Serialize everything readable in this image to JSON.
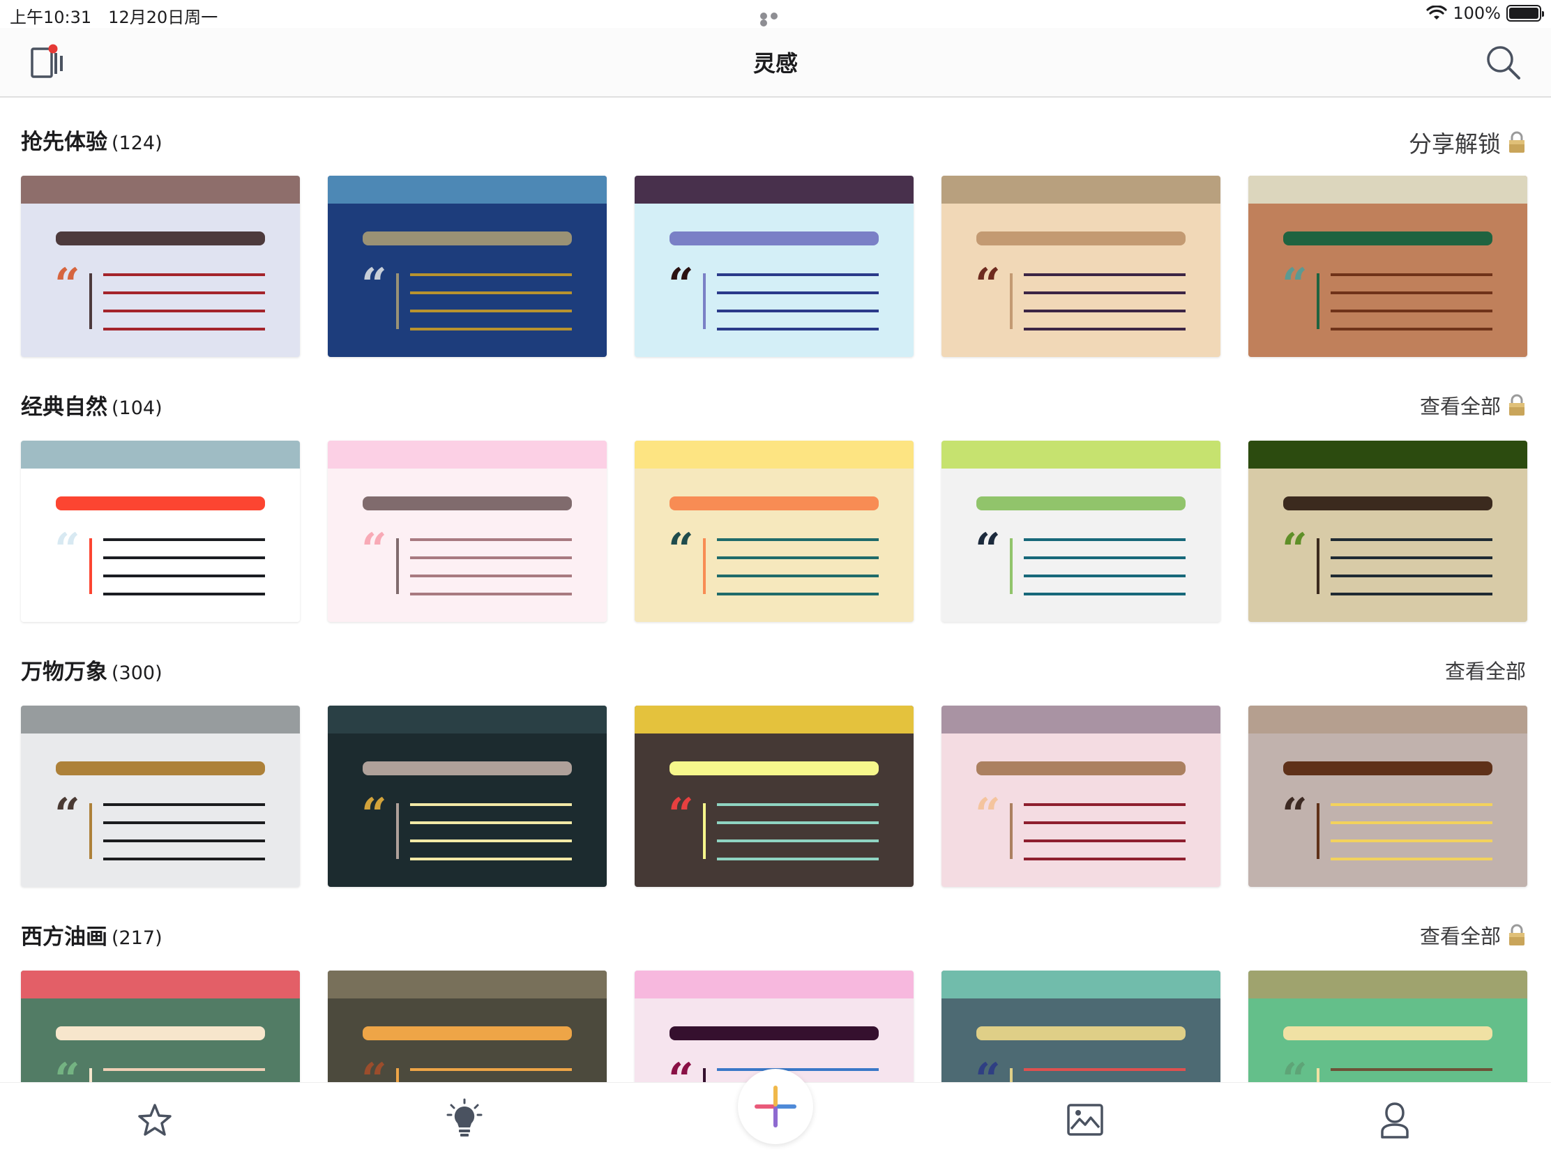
{
  "status_bar": {
    "time": "上午10:31",
    "date": "12月20日周一",
    "battery": "100%"
  },
  "nav": {
    "title": "灵感"
  },
  "sections": [
    {
      "title": "抢先体验",
      "count": "(124)",
      "action": "分享解锁",
      "locked": true,
      "cards": [
        {
          "bg": "#e0e3f1",
          "band": "#8e6e6b",
          "pill": "#4d3a3c",
          "quote": "#d6653f",
          "bar": "#4d3a3c",
          "lines": "#a4242b"
        },
        {
          "bg": "#1d3d7c",
          "band": "#4d88b5",
          "pill": "#9a9275",
          "quote": "#c8cfd8",
          "bar": "#9a9275",
          "lines": "#b8932f"
        },
        {
          "bg": "#d4eff7",
          "band": "#48304c",
          "pill": "#7a80c6",
          "quote": "#2b1111",
          "bar": "#7a80c6",
          "lines": "#2a3a8a"
        },
        {
          "bg": "#f1d8b7",
          "band": "#b8a07e",
          "pill": "#c39a72",
          "quote": "#6e2b1f",
          "bar": "#c39a72",
          "lines": "#3c2545"
        },
        {
          "bg": "#c0805b",
          "band": "#dcd6bd",
          "pill": "#1f6340",
          "quote": "#5c9a92",
          "bar": "#1f6340",
          "lines": "#6f3219"
        }
      ]
    },
    {
      "title": "经典自然",
      "count": "(104)",
      "action": "查看全部",
      "locked": true,
      "cards": [
        {
          "bg": "#ffffff",
          "band": "#9fbcc4",
          "pill": "#fc4531",
          "quote": "#d8e9f2",
          "bar": "#fc4531",
          "lines": "#1b1d22"
        },
        {
          "bg": "#fdf0f4",
          "band": "#fcd0e5",
          "pill": "#806b6d",
          "quote": "#f8aab6",
          "bar": "#806b6d",
          "lines": "#a87a80"
        },
        {
          "bg": "#f6e8bd",
          "band": "#fde482",
          "pill": "#f88c54",
          "quote": "#1f4c4d",
          "bar": "#f88c54",
          "lines": "#1f6b6a"
        },
        {
          "bg": "#f2f2f2",
          "band": "#c6e26f",
          "pill": "#91c46b",
          "quote": "#1c2a3c",
          "bar": "#91c46b",
          "lines": "#17687a"
        },
        {
          "bg": "#d8cba7",
          "band": "#2c4b0f",
          "pill": "#3b2a1e",
          "quote": "#5f8f28",
          "bar": "#3b2a1e",
          "lines": "#1f2a33"
        }
      ]
    },
    {
      "title": "万物万象",
      "count": "(300)",
      "action": "查看全部",
      "locked": false,
      "cards": [
        {
          "bg": "#e9eaec",
          "band": "#979c9e",
          "pill": "#ad8139",
          "quote": "#4a3a33",
          "bar": "#ad8139",
          "lines": "#1b1c1e"
        },
        {
          "bg": "#1c2b2f",
          "band": "#2a4045",
          "pill": "#afa19a",
          "quote": "#d2a33b",
          "bar": "#afa19a",
          "lines": "#f2e9a6"
        },
        {
          "bg": "#453935",
          "band": "#e4c23d",
          "pill": "#f6f78c",
          "quote": "#e84040",
          "bar": "#f6f78c",
          "lines": "#8fd4c2"
        },
        {
          "bg": "#f4dce2",
          "band": "#a993a3",
          "pill": "#ab8060",
          "quote": "#f4c49e",
          "bar": "#ab8060",
          "lines": "#8e1f2f"
        },
        {
          "bg": "#c1b2ad",
          "band": "#b59f8f",
          "pill": "#5f3119",
          "quote": "#3d2a23",
          "bar": "#5f3119",
          "lines": "#f3d25c"
        }
      ]
    },
    {
      "title": "西方油画",
      "count": "(217)",
      "action": "查看全部",
      "locked": true,
      "cards": [
        {
          "bg": "#527c65",
          "band": "#e35f67",
          "pill": "#f7e6cc",
          "quote": "#74b382",
          "bar": "#f7e6cc",
          "lines": "#f0cfb6"
        },
        {
          "bg": "#4c4a3d",
          "band": "#78705a",
          "pill": "#eea547",
          "quote": "#9b4d2c",
          "bar": "#eea547",
          "lines": "#eea547"
        },
        {
          "bg": "#f6e4ee",
          "band": "#f7b8de",
          "pill": "#35102e",
          "quote": "#8a1045",
          "bar": "#35102e",
          "lines": "#3a78c7"
        },
        {
          "bg": "#4d6a73",
          "band": "#71bcab",
          "pill": "#dfcf87",
          "quote": "#2f3f83",
          "bar": "#dfcf87",
          "lines": "#df504f"
        },
        {
          "bg": "#64bf8a",
          "band": "#9fa36e",
          "pill": "#f0e1a4",
          "quote": "#5ea477",
          "bar": "#f0e1a4",
          "lines": "#6e5137"
        }
      ]
    }
  ],
  "tabs": [
    {
      "name": "favorites",
      "icon": "star-icon"
    },
    {
      "name": "inspiration",
      "icon": "lightbulb-icon"
    },
    {
      "name": "create",
      "icon": "plus-icon"
    },
    {
      "name": "gallery",
      "icon": "image-icon"
    },
    {
      "name": "profile",
      "icon": "user-icon"
    }
  ],
  "colors": {
    "accent_red": "#e53935",
    "icon_gray": "#4a5260",
    "lock_gold": "#c9a55a"
  }
}
